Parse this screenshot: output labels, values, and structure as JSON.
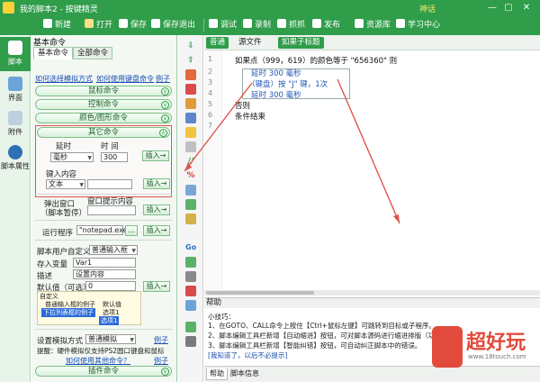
{
  "titlebar": {
    "title": "我的脚本2 - 按键精灵",
    "vip_label": "神话",
    "win_buttons": [
      "—",
      "▢",
      "✕"
    ]
  },
  "toolbar": {
    "items": [
      {
        "label": "新建",
        "icon": "plus-icon"
      },
      {
        "label": "打开",
        "icon": "folder-icon"
      },
      {
        "label": "保存",
        "icon": "save-icon"
      },
      {
        "label": "保存退出",
        "icon": "save-exit-icon"
      },
      {
        "label": "调试",
        "icon": "play-icon"
      },
      {
        "label": "录制",
        "icon": "record-icon"
      },
      {
        "label": "抓抓",
        "icon": "grab-icon"
      },
      {
        "label": "发布",
        "icon": "publish-icon"
      },
      {
        "label": "资源库",
        "icon": "library-icon"
      },
      {
        "label": "学习中心",
        "icon": "book-icon"
      }
    ]
  },
  "leftnav": {
    "items": [
      {
        "label": "脚本",
        "icon": "script-icon",
        "active": true
      },
      {
        "label": "界面",
        "icon": "ui-icon",
        "active": false
      },
      {
        "label": "附件",
        "icon": "attachment-icon",
        "active": false
      },
      {
        "label": "脚本属性",
        "icon": "info-icon",
        "active": false
      }
    ]
  },
  "panel": {
    "heading": "基本命令",
    "tabs": [
      "基本命令",
      "全部命令"
    ],
    "link_choose": "如何选择模拟方式",
    "link_keyboard": "如何使用键盘命令",
    "link_example": "例子",
    "categories": [
      "鼠标命令",
      "控制命令",
      "颜色/图形命令"
    ],
    "other": {
      "title": "其它命令",
      "delay_label": "延时",
      "time_label": "时 间",
      "unit_value": "毫秒",
      "time_value": "300",
      "insert_label": "插入→"
    },
    "key_input": {
      "label": "键入内容",
      "select_value": "文本",
      "insert_label": "插入→"
    },
    "popup_window": {
      "label1": "弹出窗口",
      "label2": "（脚本暂停）",
      "content_label": "窗口提示内容",
      "insert_label": "插入→"
    },
    "run_program": {
      "label": "运行程序",
      "value": "\"notepad.exe\"",
      "browse_label": "...",
      "insert_label": "插入→"
    },
    "user_define": {
      "label": "脚本用户自定义",
      "select_value": "普通输入框",
      "save_var_label": "存入变量",
      "save_var_value": "Var1",
      "desc_label": "描述",
      "desc_value": "设置内容",
      "default_label": "默认值（可选）",
      "default_value": "0",
      "insert_label": "插入→"
    },
    "popup_preview": {
      "title": "自定义",
      "row1_left": "普通输入框的例子",
      "row1_right": "默认值",
      "row2_left": "下拉列表框的例子",
      "row2_right": "选项1",
      "row3_right": "选项1"
    },
    "sim_mode": {
      "label": "设置模拟方式",
      "select_value": "普通模拟",
      "example_label": "例子",
      "tip": "提醒：硬件模拟仅支持PS2圆口键盘和鼠标"
    },
    "plugin_link": "如何使用其他命令？",
    "plugin_example": "例子",
    "plugin_cmd": "插件命令"
  },
  "editor_tabs": {
    "normal": "普通",
    "source": "源文件",
    "tag": "如果子标题"
  },
  "editor": {
    "line_numbers": [
      "1",
      "2",
      "3",
      "4",
      "5",
      "6",
      "7"
    ],
    "lines": [
      "如果点（999，619）的颜色等于 \"656360\" 则",
      "延时 300 毫秒",
      "（键盘）按 \"J\" 键，1次",
      "延时 300 毫秒",
      "否则",
      "条件结束"
    ]
  },
  "help": {
    "title": "帮助",
    "lines": [
      "小技巧：",
      "1、在GOTO、CALL命令上按住【Ctrl+鼠标左键】可跳转到目标或子程序。",
      "2、脚本编辑工具栏新增【自动缩进】按钮，可对脚本源码进行缩进排版（功能：",
      "3、脚本编辑工具栏新增【智能纠错】按钮，可自动纠正脚本中的错误。",
      "[我知道了，以后不必提示]"
    ],
    "tabs": [
      "帮助",
      "脚本信息"
    ]
  },
  "watermark": {
    "brand": "超好玩",
    "url": "www.18touch.com"
  },
  "colors": {
    "brand_green": "#2f9d4a",
    "annotation_red": "#e0554a",
    "code_blue": "#2357b8"
  }
}
